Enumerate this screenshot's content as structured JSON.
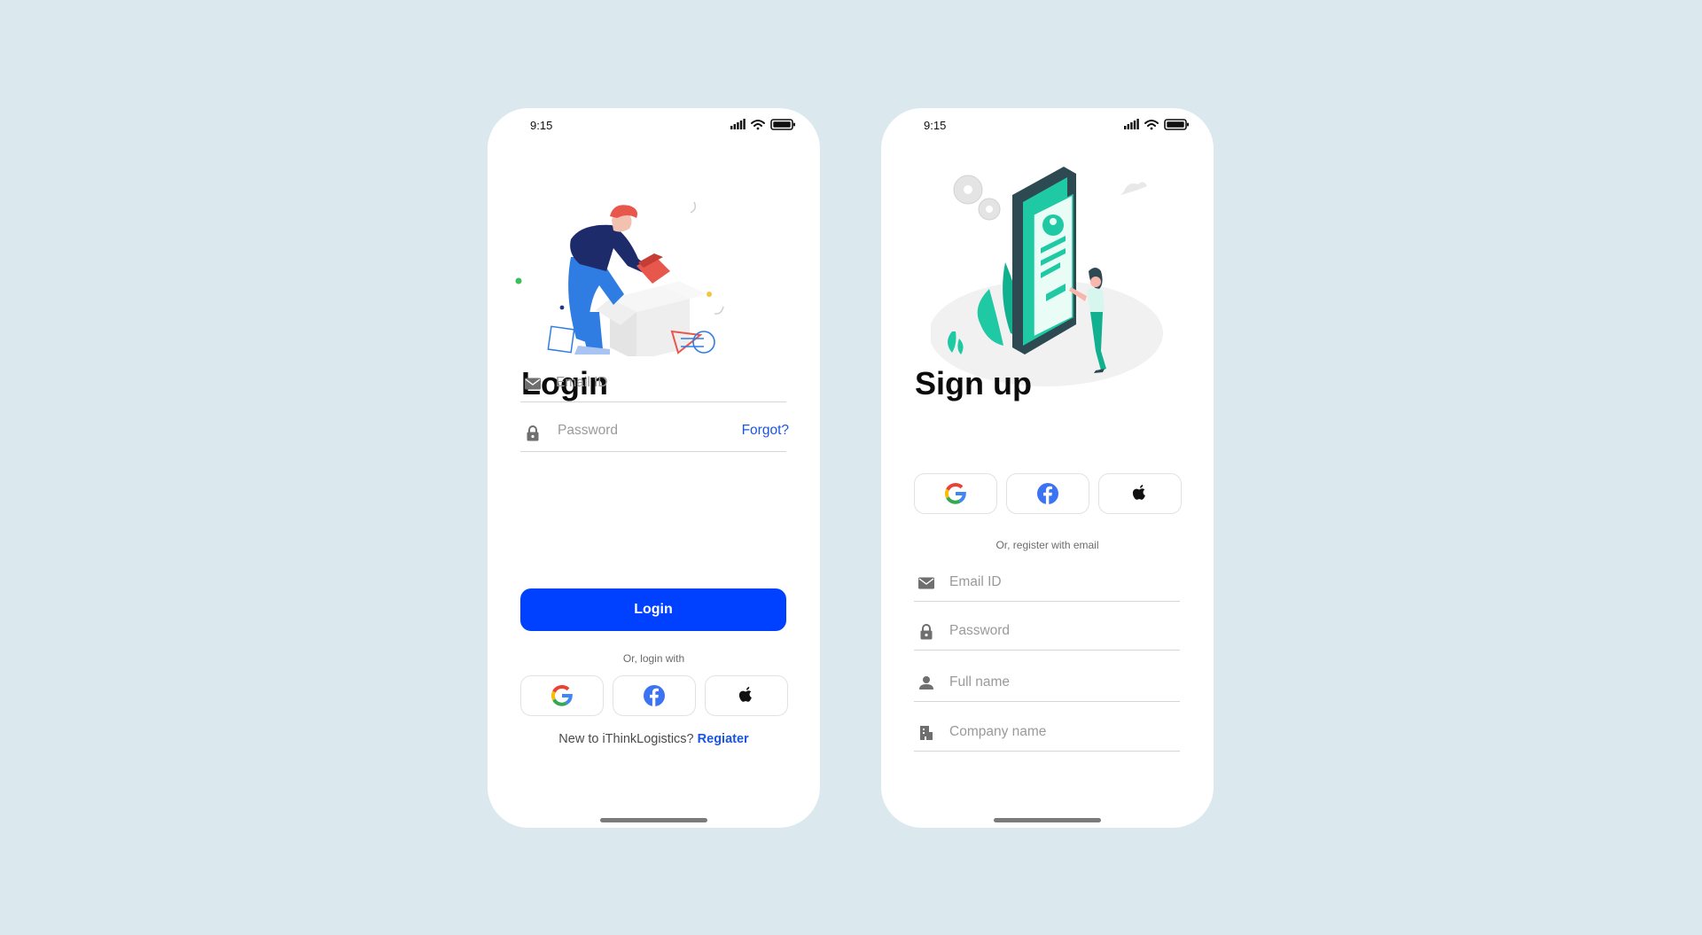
{
  "status": {
    "time": "9:15"
  },
  "login": {
    "title": "Login",
    "email_placeholder": "Email ID",
    "password_placeholder": "Password",
    "forgot_label": "Forgot?",
    "login_button": "Login",
    "divider": "Or, login with",
    "footer_text": "New to iThinkLogistics?",
    "register_link": "Regiater"
  },
  "signup": {
    "title": "Sign up",
    "divider": "Or, register with email",
    "email_placeholder": "Email ID",
    "password_placeholder": "Password",
    "fullname_placeholder": "Full name",
    "company_placeholder": "Company name"
  },
  "icons": [
    "signal-icon",
    "wifi-icon",
    "battery-icon",
    "mail-icon",
    "lock-icon",
    "person-icon",
    "building-icon",
    "google-icon",
    "facebook-icon",
    "apple-icon"
  ],
  "colors": {
    "primary": "#0040ff",
    "link": "#1b55e2",
    "background": "#dbe9ef"
  }
}
